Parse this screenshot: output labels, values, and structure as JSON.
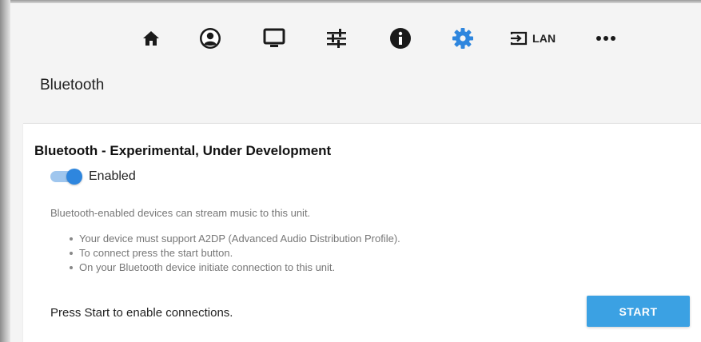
{
  "nav": {
    "items": [
      {
        "icon": "home-icon"
      },
      {
        "icon": "user-icon"
      },
      {
        "icon": "monitor-icon"
      },
      {
        "icon": "sliders-icon"
      },
      {
        "icon": "info-icon"
      },
      {
        "icon": "gear-icon",
        "active": true,
        "color": "#2e86de"
      },
      {
        "icon": "input-icon",
        "label": "LAN"
      },
      {
        "icon": "more-icon"
      }
    ]
  },
  "page": {
    "title": "Bluetooth"
  },
  "card": {
    "title": "Bluetooth - Experimental, Under Development",
    "toggle": {
      "label": "Enabled",
      "checked": true
    },
    "description": "Bluetooth-enabled devices can stream music to this unit.",
    "bullets": [
      "Your device must support A2DP (Advanced Audio Distribution Profile).",
      "To connect press the start button.",
      "On your Bluetooth device initiate connection to this unit."
    ],
    "footer_text": "Press Start to enable connections.",
    "start_button": "START"
  },
  "colors": {
    "accent": "#2e86de",
    "button": "#3ba1e3",
    "toggle_track": "#9fc6ee"
  }
}
